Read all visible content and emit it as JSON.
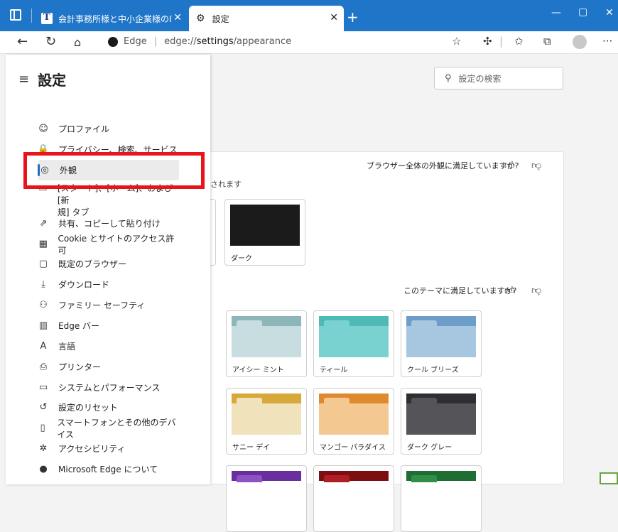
{
  "window": {
    "tabs": [
      {
        "label": "会計事務所様と中小企業様のITと",
        "active": false
      },
      {
        "label": "設定",
        "active": true
      }
    ]
  },
  "address": {
    "brand": "Edge",
    "url_scheme": "edge://",
    "url_host": "settings",
    "url_path": "/appearance"
  },
  "sidebar": {
    "title": "設定",
    "items": [
      {
        "icon": "profile-icon",
        "glyph": "☺",
        "label": "プロファイル"
      },
      {
        "icon": "lock-icon",
        "glyph": "🔒",
        "label": "プライバシー、検索、サービス"
      },
      {
        "icon": "palette-icon",
        "glyph": "◎",
        "label": "外観",
        "active": true
      },
      {
        "icon": "start-home-icon",
        "glyph": "▭",
        "label_line1": "[スタート]、[ホーム]、および [新",
        "label_line2": "規] タブ"
      },
      {
        "icon": "share-icon",
        "glyph": "⇗",
        "label": "共有、コピーして貼り付け"
      },
      {
        "icon": "cookie-icon",
        "glyph": "▦",
        "label": "Cookie とサイトのアクセス許可"
      },
      {
        "icon": "default-browser-icon",
        "glyph": "▢",
        "label": "既定のブラウザー"
      },
      {
        "icon": "download-icon",
        "glyph": "⤓",
        "label": "ダウンロード"
      },
      {
        "icon": "family-icon",
        "glyph": "⚇",
        "label": "ファミリー セーフティ"
      },
      {
        "icon": "edge-bar-icon",
        "glyph": "▥",
        "label": "Edge バー"
      },
      {
        "icon": "language-icon",
        "glyph": "A",
        "label": "言語"
      },
      {
        "icon": "printer-icon",
        "glyph": "⎙",
        "label": "プリンター"
      },
      {
        "icon": "system-icon",
        "glyph": "▭",
        "label": "システムとパフォーマンス"
      },
      {
        "icon": "reset-icon",
        "glyph": "↺",
        "label": "設定のリセット"
      },
      {
        "icon": "phone-icon",
        "glyph": "▯",
        "label": "スマートフォンとその他のデバイス"
      },
      {
        "icon": "accessibility-icon",
        "glyph": "✲",
        "label": "アクセシビリティ"
      },
      {
        "icon": "edge-logo-icon",
        "glyph": "●",
        "label": "Microsoft Edge について"
      }
    ]
  },
  "main": {
    "search_placeholder": "設定の検索",
    "feedback1": "ブラウザー全体の外観に満足していますか?",
    "feedback2": "このテーマに満足していますか?",
    "partial_text": "されます",
    "appearance_dark": "ダーク",
    "themes": [
      {
        "name": "アイシー ミント",
        "top": "#8db6bb",
        "tab": "#c7dde0",
        "body": "#c7dde0"
      },
      {
        "name": "ティール",
        "top": "#4fb9b7",
        "tab": "#79d2d0",
        "body": "#79d2d0"
      },
      {
        "name": "クール ブリーズ",
        "top": "#6d9ec9",
        "tab": "#a7c6e0",
        "body": "#a7c6e0"
      },
      {
        "name": "サニー デイ",
        "top": "#d7a93a",
        "tab": "#f0e2bb",
        "body": "#f0e2bb"
      },
      {
        "name": "マンゴー パラダイス",
        "top": "#e08a2f",
        "tab": "#f3c891",
        "body": "#f3c891"
      },
      {
        "name": "ダーク グレー",
        "top": "#2f2f33",
        "tab": "#555559",
        "body": "#555559"
      }
    ],
    "themes_row3": [
      {
        "top": "#6a2f9e",
        "tab": "#8e52c4"
      },
      {
        "top": "#7c0f12",
        "tab": "#b01e24"
      },
      {
        "top": "#1f6d33",
        "tab": "#2f8f47"
      }
    ]
  },
  "colors": {
    "titlebar": "#1f76c8",
    "highlight": "#e8141c",
    "accent": "#1f6fc0"
  }
}
